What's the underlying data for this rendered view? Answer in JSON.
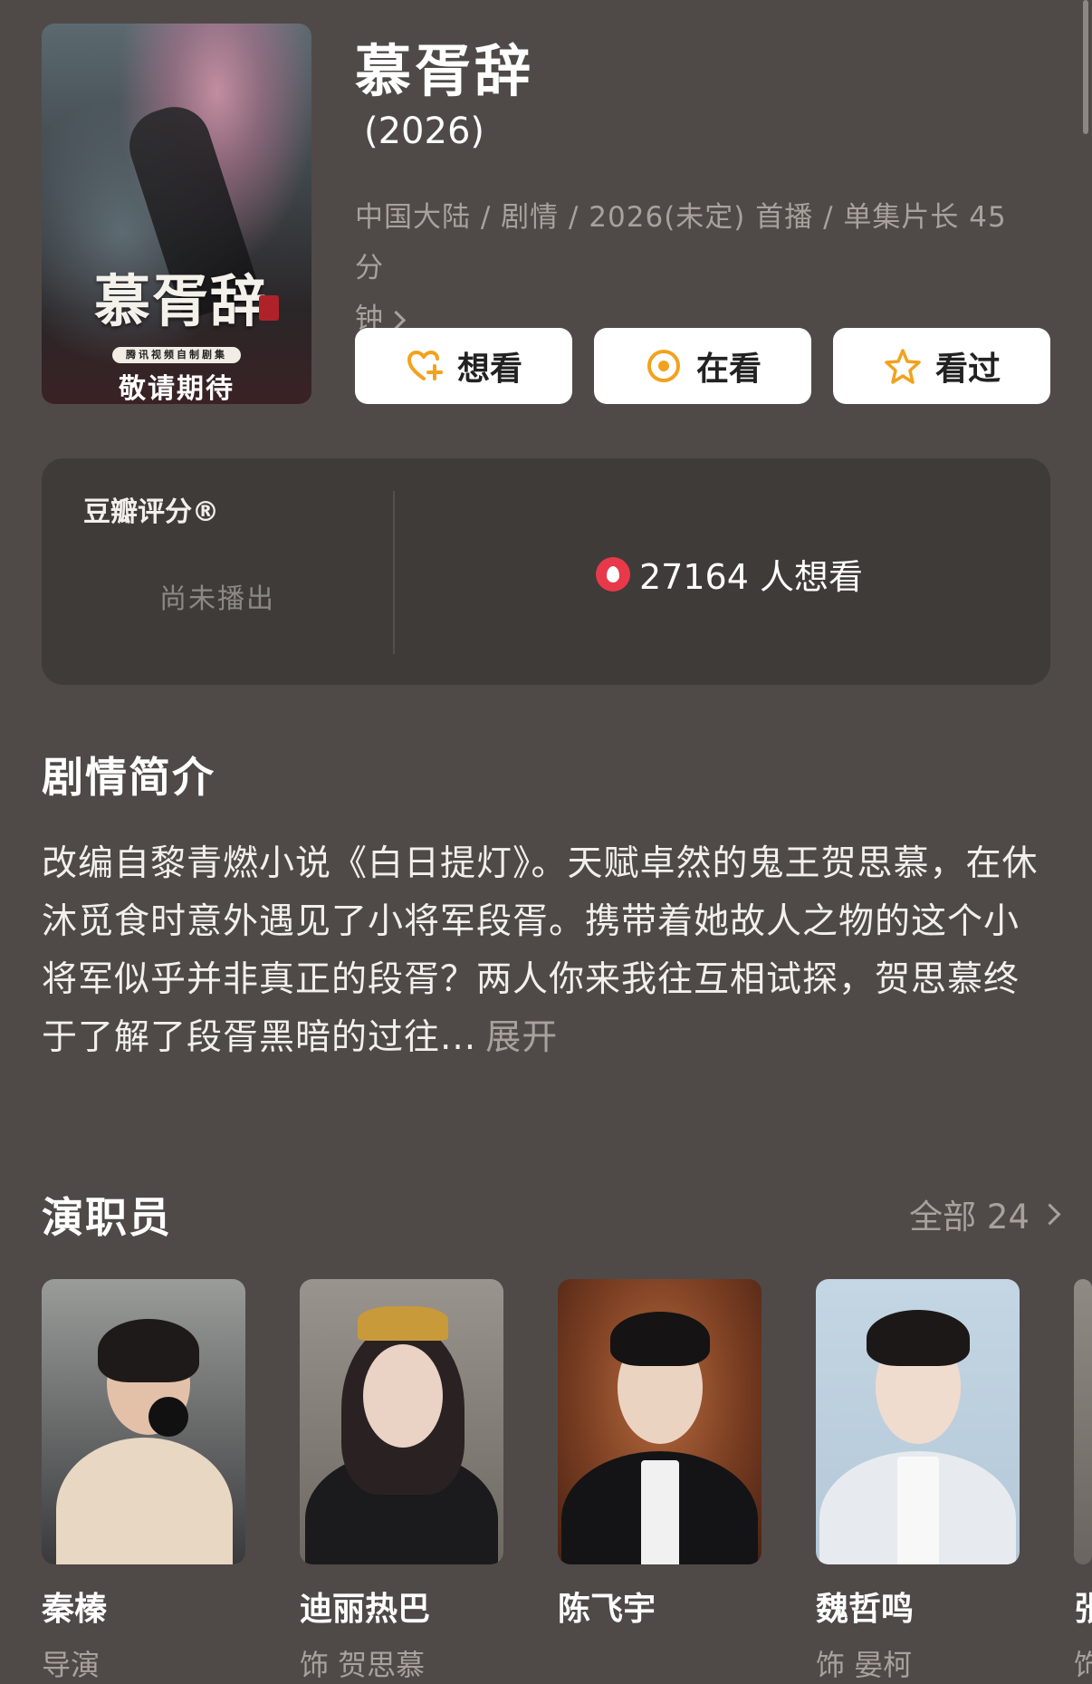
{
  "show": {
    "title": "慕胥辞",
    "year": "(2026)",
    "meta_line1": "中国大陆 / 剧情 / 2026(未定) 首播 / 单集片长 45 分",
    "meta_line2": "钟",
    "poster": {
      "calligraphy": "慕胥辞",
      "pill": "腾讯视频自制剧集",
      "tagline": "敬请期待"
    }
  },
  "actions": {
    "want": "想看",
    "watching": "在看",
    "watched": "看过"
  },
  "rating": {
    "label": "豆瓣评分®",
    "status": "尚未播出",
    "wish_count": "27164 人想看"
  },
  "synopsis": {
    "heading": "剧情简介",
    "text": "改编自黎青燃小说《白日提灯》。天赋卓然的鬼王贺思慕，在休沐觅食时意外遇见了小将军段胥。携带着她故人之物的这个小将军似乎并非真正的段胥？两人你来我往互相试探，贺思慕终于了解了段胥黑暗的过往...",
    "more": "展开"
  },
  "cast": {
    "heading": "演职员",
    "all_label": "全部 24",
    "members": [
      {
        "name": "秦榛",
        "role": "导演"
      },
      {
        "name": "迪丽热巴",
        "role": "饰 贺思慕"
      },
      {
        "name": "陈飞宇",
        "role": ""
      },
      {
        "name": "魏哲鸣",
        "role": "饰 晏柯"
      },
      {
        "name": "张",
        "role": "饰"
      }
    ]
  },
  "colors": {
    "background": "#4f4a48",
    "card": "#3f3b39",
    "accent_orange": "#f2a21d",
    "flame_red": "#e8394a",
    "muted_text": "#a8a19c"
  }
}
